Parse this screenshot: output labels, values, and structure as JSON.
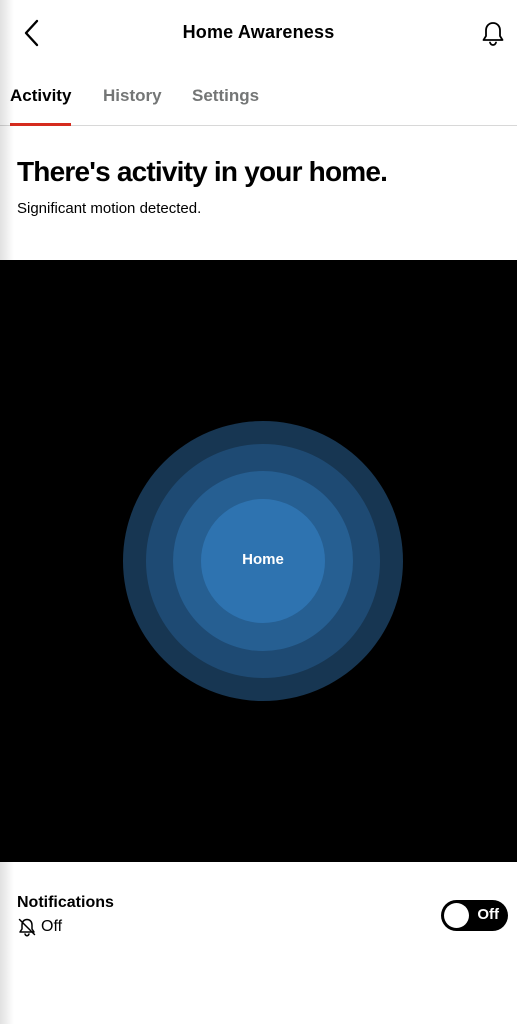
{
  "header": {
    "title": "Home Awareness",
    "back_icon": "chevron-left-icon",
    "bell_icon": "bell-icon"
  },
  "tabs": [
    {
      "label": "Activity",
      "active": true
    },
    {
      "label": "History",
      "active": false
    },
    {
      "label": "Settings",
      "active": false
    }
  ],
  "status": {
    "headline": "There's activity in your home.",
    "subline": "Significant motion detected."
  },
  "map": {
    "center_label": "Home",
    "ring_colors": [
      "#173652",
      "#1e4a73",
      "#265f92",
      "#2e73b0"
    ]
  },
  "notifications": {
    "title": "Notifications",
    "status_icon": "bell-off-icon",
    "status_text": "Off",
    "toggle_label": "Off",
    "toggle_on": false
  },
  "colors": {
    "accent": "#d52b1e",
    "toggle_bg": "#000000"
  }
}
